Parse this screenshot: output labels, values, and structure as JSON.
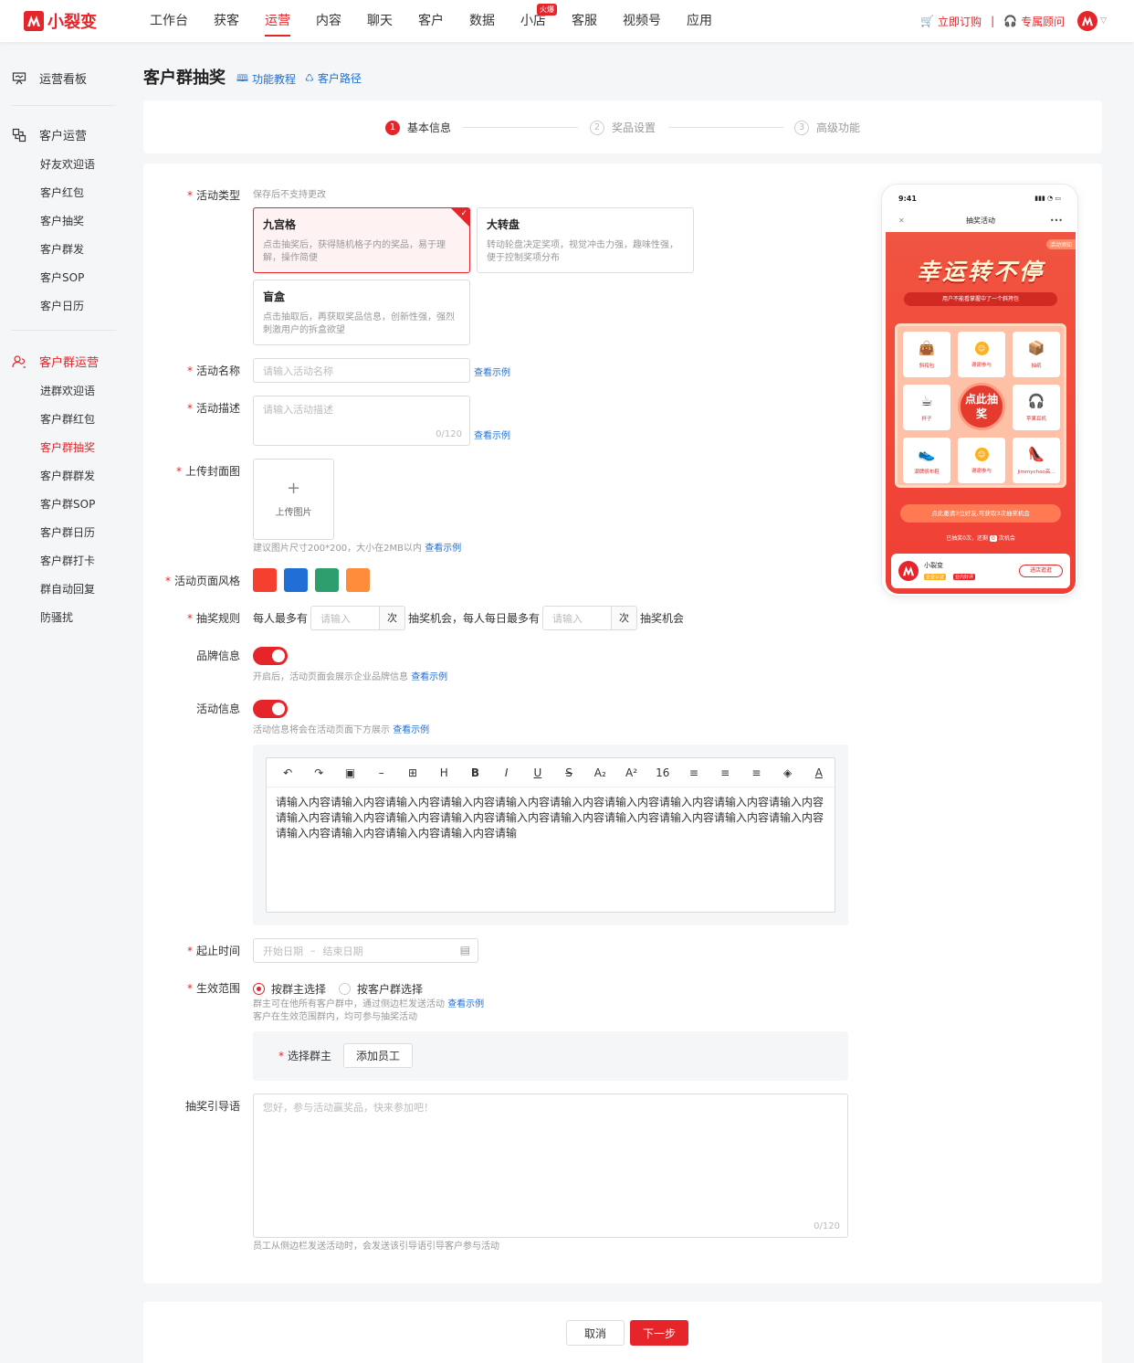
{
  "brand": {
    "name": "小裂变",
    "color": "#e5252a"
  },
  "nav": {
    "items": [
      "工作台",
      "获客",
      "运营",
      "内容",
      "聊天",
      "客户",
      "数据",
      "小店",
      "客服",
      "视频号",
      "应用"
    ],
    "active_index": 2,
    "hot_badge": "火爆",
    "order_label": "立即订购",
    "consultant_label": "专属顾问"
  },
  "sidebar": {
    "dashboard": "运营看板",
    "customer_ops": {
      "title": "客户运营",
      "items": [
        "好友欢迎语",
        "客户红包",
        "客户抽奖",
        "客户群发",
        "客户SOP",
        "客户日历"
      ]
    },
    "group_ops": {
      "title": "客户群运营",
      "items": [
        "进群欢迎语",
        "客户群红包",
        "客户群抽奖",
        "客户群群发",
        "客户群SOP",
        "客户群日历",
        "客户群打卡",
        "群自动回复",
        "防骚扰"
      ],
      "active_index": 2
    }
  },
  "page": {
    "title": "客户群抽奖",
    "tutorial_link": "功能教程",
    "path_link": "客户路径"
  },
  "steps": [
    {
      "num": "1",
      "label": "基本信息",
      "active": true
    },
    {
      "num": "2",
      "label": "奖品设置",
      "active": false
    },
    {
      "num": "3",
      "label": "高级功能",
      "active": false
    }
  ],
  "form": {
    "type": {
      "label": "活动类型",
      "hint": "保存后不支持更改",
      "options": [
        {
          "title": "九宫格",
          "desc": "点击抽奖后，获得随机格子内的奖品，易于理解，操作简便",
          "selected": true
        },
        {
          "title": "大转盘",
          "desc": "转动轮盘决定奖项，视觉冲击力强，趣味性强，便于控制奖项分布",
          "selected": false
        },
        {
          "title": "盲盒",
          "desc": "点击抽取后，再获取奖品信息，创新性强，强烈刺激用户的拆盒欲望",
          "selected": false
        }
      ]
    },
    "name": {
      "label": "活动名称",
      "placeholder": "请输入活动名称",
      "example": "查看示例"
    },
    "desc": {
      "label": "活动描述",
      "placeholder": "请输入活动描述",
      "count": "0/120",
      "example": "查看示例"
    },
    "cover": {
      "label": "上传封面图",
      "button": "上传图片",
      "hint": "建议图片尺寸200*200，大小在2MB以内",
      "example": "查看示例"
    },
    "style": {
      "label": "活动页面风格",
      "colors": [
        "#f5402f",
        "#1f6fd6",
        "#2e9e6f",
        "#ff8c3a"
      ]
    },
    "rule": {
      "label": "抽奖规则",
      "text1": "每人最多有",
      "placeholder": "请输入",
      "unit": "次",
      "text2": "抽奖机会，每人每日最多有",
      "text3": "抽奖机会"
    },
    "brand_info": {
      "label": "品牌信息",
      "on": true,
      "hint": "开启后，活动页面会展示企业品牌信息",
      "example": "查看示例"
    },
    "activity_info": {
      "label": "活动信息",
      "on": true,
      "hint": "活动信息将会在活动页面下方展示",
      "example": "查看示例"
    },
    "editor": {
      "toolbar": [
        {
          "icon": "undo-icon",
          "glyph": "↶"
        },
        {
          "icon": "redo-icon",
          "glyph": "↷"
        },
        {
          "icon": "image-icon",
          "glyph": "▣"
        },
        {
          "icon": "divider-icon",
          "glyph": "–"
        },
        {
          "icon": "table-icon",
          "glyph": "⊞"
        },
        {
          "icon": "heading-icon",
          "glyph": "H"
        },
        {
          "icon": "bold-icon",
          "glyph": "B"
        },
        {
          "icon": "italic-icon",
          "glyph": "I"
        },
        {
          "icon": "underline-icon",
          "glyph": "U"
        },
        {
          "icon": "strikethrough-icon",
          "glyph": "S"
        },
        {
          "icon": "subscript-icon",
          "glyph": "A₂"
        },
        {
          "icon": "superscript-icon",
          "glyph": "A²"
        },
        {
          "icon": "font-size-icon",
          "glyph": "16"
        },
        {
          "icon": "align-left-icon",
          "glyph": "≡"
        },
        {
          "icon": "align-center-icon",
          "glyph": "≡"
        },
        {
          "icon": "align-right-icon",
          "glyph": "≡"
        },
        {
          "icon": "fill-color-icon",
          "glyph": "◈"
        },
        {
          "icon": "font-color-icon",
          "glyph": "A"
        }
      ],
      "content": "请输入内容请输入内容请输入内容请输入内容请输入内容请输入内容请输入内容请输入内容请输入内容请输入内容请输入内容请输入内容请输入内容请输入内容请输入内容请输入内容请输入内容请输入内容请输入内容请输入内容请输入内容请输入内容请输入内容请输入内容请输"
    },
    "time": {
      "label": "起止时间",
      "start_placeholder": "开始日期",
      "sep": "–",
      "end_placeholder": "结束日期"
    },
    "scope": {
      "label": "生效范围",
      "options": [
        {
          "label": "按群主选择",
          "on": true
        },
        {
          "label": "按客户群选择",
          "on": false
        }
      ],
      "hint1": "群主可在他所有客户群中，通过侧边栏发送活动",
      "example": "查看示例",
      "hint2": "客户在生效范围群内，均可参与抽奖活动",
      "owner_label": "选择群主",
      "owner_button": "添加员工"
    },
    "guide": {
      "label": "抽奖引导语",
      "placeholder": "您好，参与活动赢奖品，快来参加吧！",
      "count": "0/120",
      "hint": "员工从侧边栏发送活动时，会发送该引导语引导客户参与活动"
    }
  },
  "preview": {
    "time": "9:41",
    "nav_title": "抽奖活动",
    "rules_tag": "活动须知",
    "headline": "幸运转不停",
    "winner_text": "用户不能看掌握中了一个斜挎包",
    "cells": [
      {
        "icon": "handbag-icon",
        "glyph": "👜",
        "label": "斜挎包"
      },
      {
        "icon": "coin-icon",
        "glyph": "",
        "label": "谢谢参与"
      },
      {
        "icon": "box-icon",
        "glyph": "📦",
        "label": "抽纸"
      },
      {
        "icon": "cup-icon",
        "glyph": "☕",
        "label": "杯子"
      },
      {
        "icon": "earbuds-icon",
        "glyph": "🎧",
        "label": "苹果耳机"
      },
      {
        "icon": "shoe-icon",
        "glyph": "👟",
        "label": "潮牌帆布鞋"
      },
      {
        "icon": "coin-icon",
        "glyph": "",
        "label": "谢谢参与"
      },
      {
        "icon": "heels-icon",
        "glyph": "👠",
        "label": "Jimmychoo高..."
      }
    ],
    "draw_button": "点此抽奖",
    "invite_text": "点此邀请3位好友,可获取3次抽奖机会",
    "remain_prefix": "已抽奖0次，还剩",
    "remain_count": "0",
    "remain_suffix": "次机会",
    "brand_name": "小裂变",
    "brand_tag1": "企业认证",
    "brand_tag2": "业内好评",
    "brand_button": "进店逛逛"
  },
  "footer": {
    "cancel": "取消",
    "next": "下一步"
  }
}
